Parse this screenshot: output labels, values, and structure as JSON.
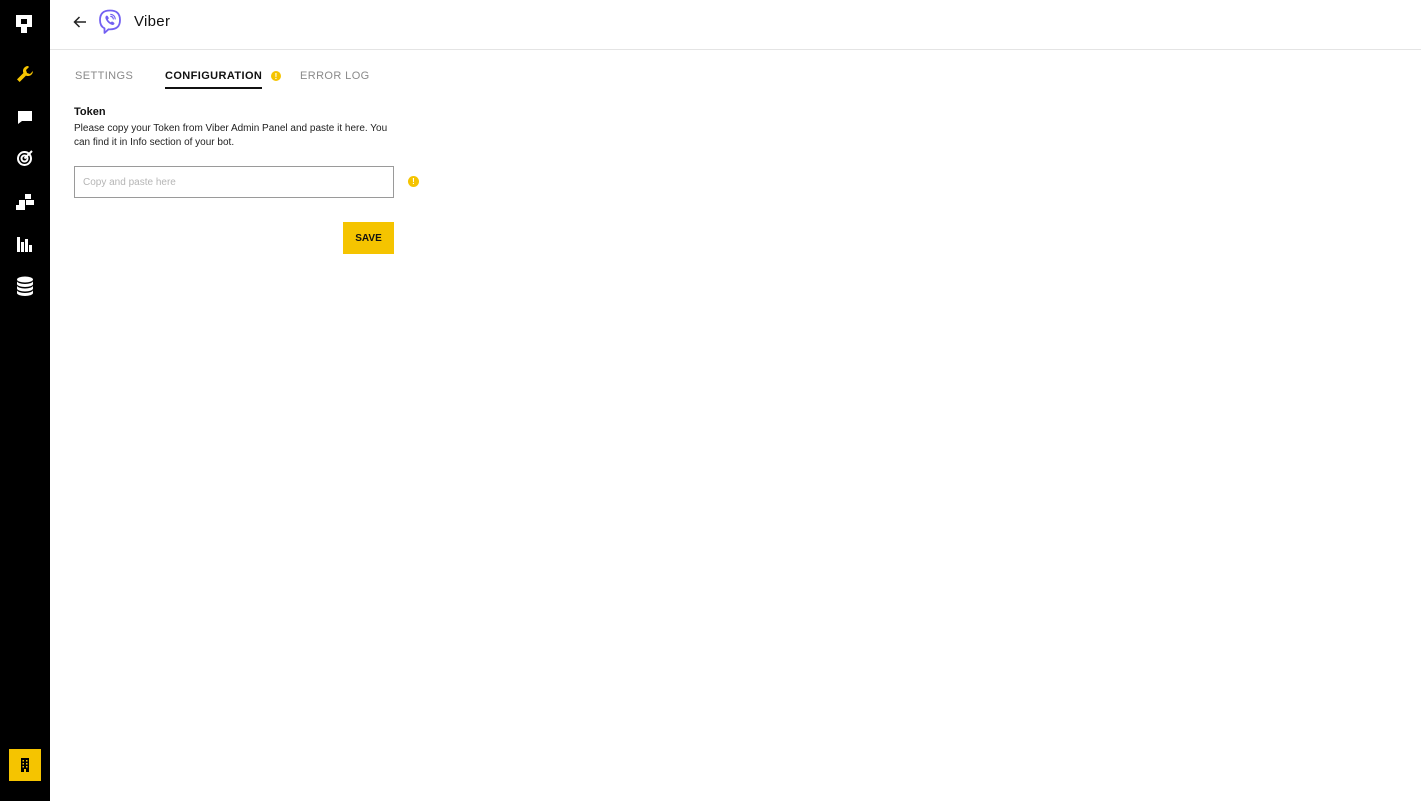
{
  "sidebar": {
    "items": [
      {
        "icon": "logo-icon"
      },
      {
        "icon": "wrench-icon"
      },
      {
        "icon": "chat-icon"
      },
      {
        "icon": "target-icon"
      },
      {
        "icon": "blocks-icon"
      },
      {
        "icon": "bar-chart-icon"
      },
      {
        "icon": "database-icon"
      }
    ],
    "bottom_icon": "building-icon"
  },
  "header": {
    "title": "Viber",
    "back_icon": "arrow-left-icon",
    "app_icon": "viber-icon"
  },
  "tabs": [
    {
      "label": "SETTINGS",
      "active": false
    },
    {
      "label": "CONFIGURATION",
      "active": true,
      "warning": "!"
    },
    {
      "label": "ERROR LOG",
      "active": false
    }
  ],
  "form": {
    "token_label": "Token",
    "token_help": "Please copy your Token from Viber Admin Panel and paste it here. You can find it in Info section of your bot.",
    "token_placeholder": "Copy and paste here",
    "token_value": "",
    "warning_mark": "!",
    "save_label": "SAVE"
  },
  "colors": {
    "accent": "#f5c400",
    "sidebar_bg": "#000000",
    "viber_purple": "#7360f2"
  }
}
